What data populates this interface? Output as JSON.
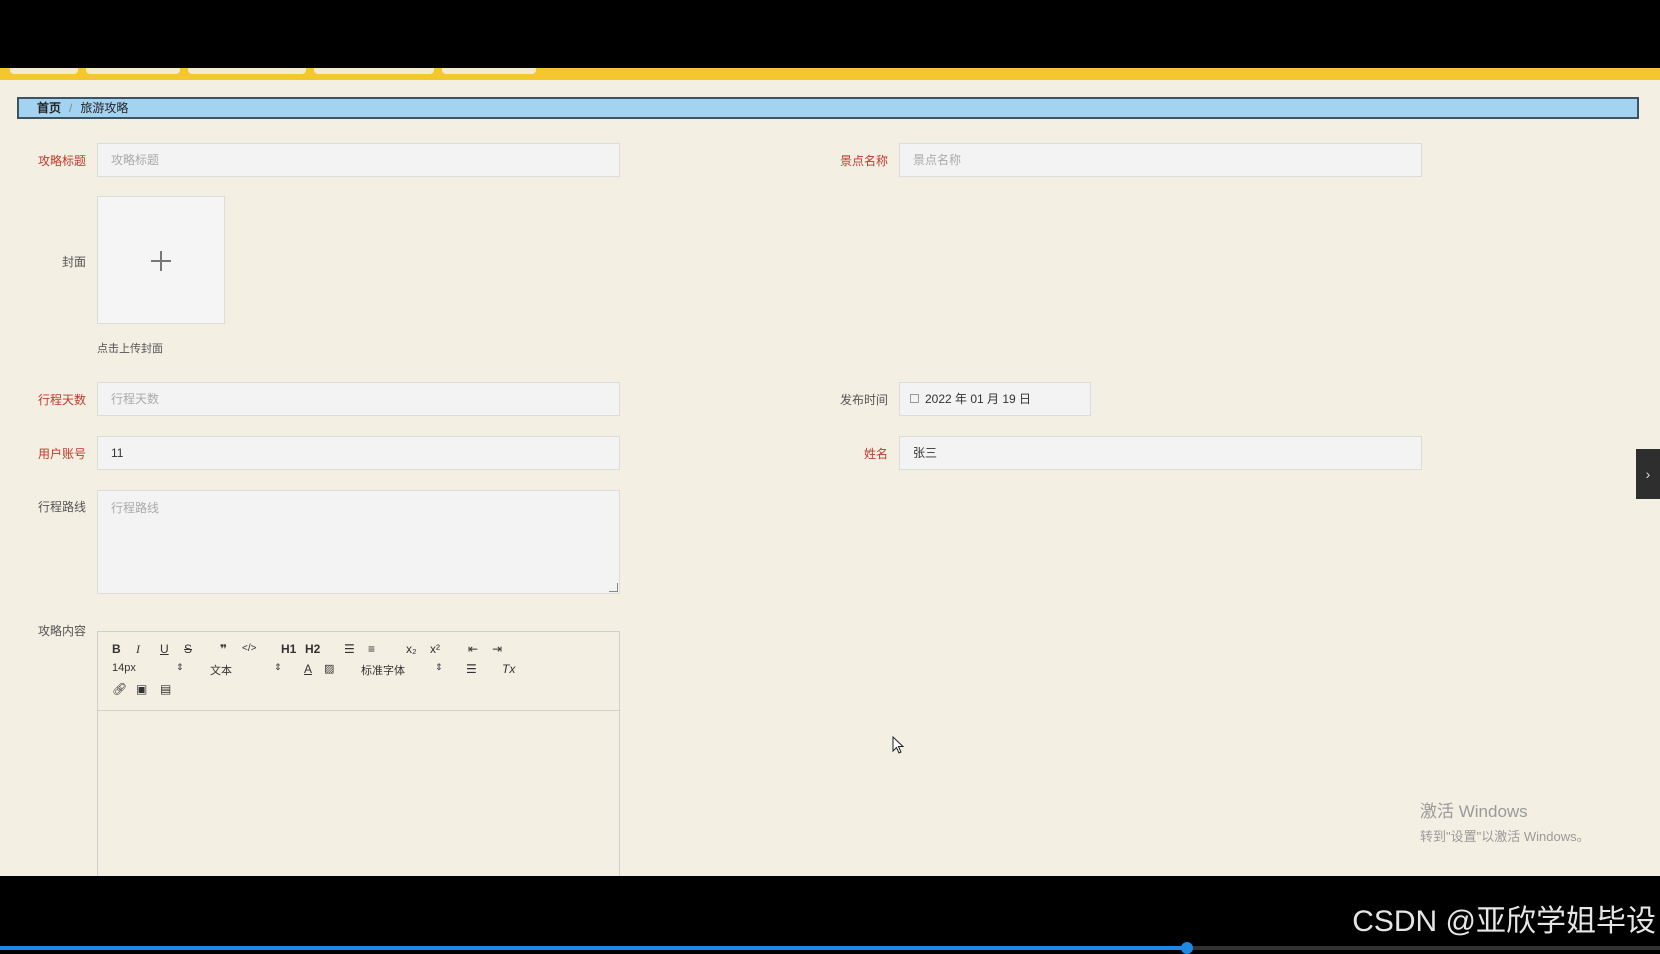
{
  "breadcrumb": {
    "home": "首页",
    "separator": "/",
    "current": "旅游攻略"
  },
  "form": {
    "title": {
      "label": "攻略标题",
      "placeholder": "攻略标题"
    },
    "scenic": {
      "label": "景点名称",
      "placeholder": "景点名称"
    },
    "cover": {
      "label": "封面",
      "hint": "点击上传封面"
    },
    "days": {
      "label": "行程天数",
      "placeholder": "行程天数"
    },
    "publish_time": {
      "label": "发布时间",
      "value": "2022 年 01 月 19 日"
    },
    "account": {
      "label": "用户账号",
      "value": "11"
    },
    "name": {
      "label": "姓名",
      "value": "张三"
    },
    "route": {
      "label": "行程路线",
      "placeholder": "行程路线"
    },
    "content": {
      "label": "攻略内容"
    }
  },
  "editor": {
    "font_size": "14px",
    "block_type": "文本",
    "font_family": "标准字体",
    "buttons": [
      "B",
      "I",
      "U",
      "S",
      "❞",
      "</>",
      "H1",
      "H2",
      "ordered-list",
      "bullet-list",
      "x₂",
      "x²",
      "outdent",
      "indent",
      "A",
      "highlight",
      "align",
      "Tx",
      "link",
      "image",
      "video"
    ]
  },
  "side_toggle": "›",
  "watermark": {
    "line1": "激活 Windows",
    "line2": "转到\"设置\"以激活 Windows。"
  },
  "overlay_text": "CSDN @亚欣学姐毕设",
  "video_progress": 0.715,
  "colors": {
    "accent": "#f5c72e",
    "breadcrumb_bg": "#a4d2f1",
    "required": "#c0392b",
    "page_bg": "#f4efe3"
  }
}
